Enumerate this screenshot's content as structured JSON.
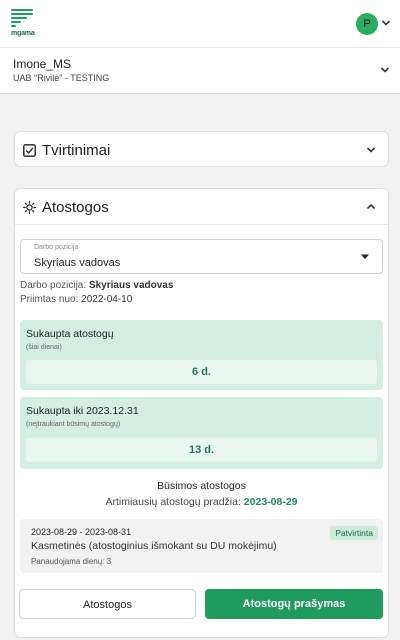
{
  "header": {
    "logo_text": "mgama",
    "avatar_initial": "P",
    "brand_color": "#1a9e63",
    "avatar_color": "#27ae60"
  },
  "company": {
    "name": "Imone_MS",
    "sub": "UAB \"Rivilė\" - TESTING"
  },
  "tvirtinimai": {
    "title": "Tvirtinimai",
    "expanded": false
  },
  "atostogos": {
    "title": "Atostogos",
    "expanded": true,
    "select": {
      "label": "Darbo pozicija",
      "value": "Skyriaus vadovas"
    },
    "position_label": "Darbo pozicija:",
    "position_value": "Skyriaus vadovas",
    "hired_label": "Priimtas nuo:",
    "hired_value": "2022-04-10",
    "accrued": {
      "title": "Sukaupta atostogų",
      "subtitle": "(šiai dienai)",
      "value": "6 d."
    },
    "accrued_until": {
      "title": "Sukaupta iki 2023.12.31",
      "subtitle": "(neįtraukiant būsimų atostogų)",
      "value": "13 d."
    },
    "future_title": "Būsimos atostogos",
    "nearest_label": "Artimiausių atostogų pradžia:",
    "nearest_value": "2023-08-29",
    "items": [
      {
        "dates": "2023-08-29 - 2023-08-31",
        "type": "Kasmetinės (atostoginius išmokant su DU mokėjimu)",
        "days": "Panaudojama dienų: 3",
        "status": "Patvirtinta"
      }
    ],
    "btn_vacations": "Atostogos",
    "btn_requests": "Atostogų prašymas",
    "accent_color": "#1f9b5d",
    "green_bg": "#d4eee1"
  }
}
